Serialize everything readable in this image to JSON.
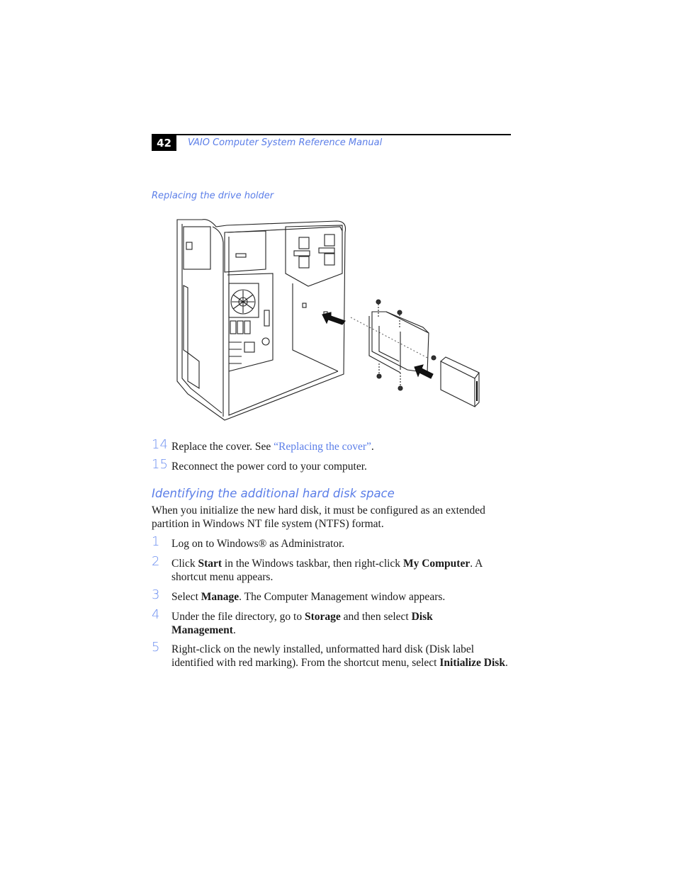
{
  "header": {
    "page_number": "42",
    "running_title": "VAIO Computer System Reference Manual"
  },
  "figure": {
    "caption": "Replacing the drive holder",
    "illustration": "computer-case-with-drive-holder-and-hard-disk"
  },
  "steps_top": [
    {
      "number": "14",
      "text_before": "Replace the cover. See ",
      "link": "“Replacing the cover”",
      "text_after": "."
    },
    {
      "number": "15",
      "text": "Reconnect the power cord to your computer."
    }
  ],
  "section": {
    "heading": "Identifying the additional hard disk space",
    "intro": "When you initialize the new hard disk, it must be configured as an extended partition in Windows NT file system (NTFS) format."
  },
  "steps": [
    {
      "number": "1",
      "parts": [
        {
          "t": "Log on to Windows® as Administrator."
        }
      ]
    },
    {
      "number": "2",
      "parts": [
        {
          "t": "Click "
        },
        {
          "b": "Start"
        },
        {
          "t": " in the Windows taskbar, then right-click "
        },
        {
          "b": "My Computer"
        },
        {
          "t": ". A shortcut menu appears."
        }
      ]
    },
    {
      "number": "3",
      "parts": [
        {
          "t": "Select "
        },
        {
          "b": "Manage"
        },
        {
          "t": ". The Computer Management window appears."
        }
      ]
    },
    {
      "number": "4",
      "parts": [
        {
          "t": "Under the file directory, go to "
        },
        {
          "b": "Storage"
        },
        {
          "t": " and then select "
        },
        {
          "b": "Disk Management"
        },
        {
          "t": "."
        }
      ]
    },
    {
      "number": "5",
      "parts": [
        {
          "t": "Right-click on the newly installed, unformatted hard disk (Disk label identified with red marking). From the shortcut menu, select "
        },
        {
          "b": "Initialize Disk"
        },
        {
          "t": "."
        }
      ]
    }
  ],
  "colors": {
    "accent": "#5b7ee8",
    "step_number": "#6b8ef0",
    "text": "#1a1a1a"
  }
}
